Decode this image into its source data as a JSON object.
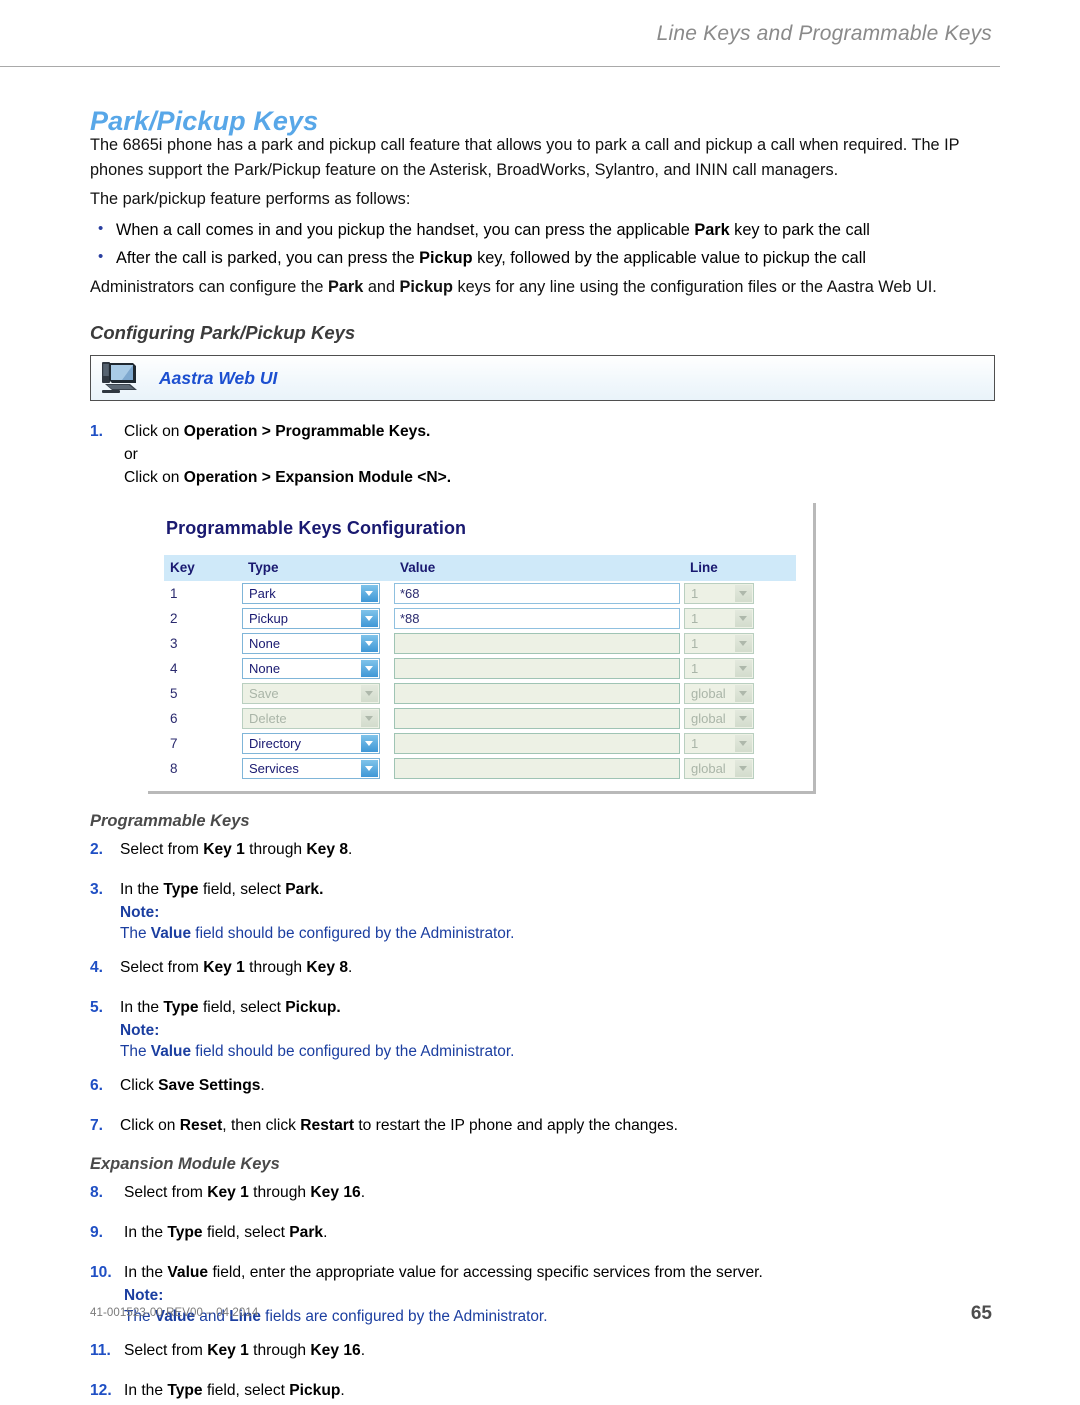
{
  "header": {
    "running_head": "Line Keys and Programmable Keys"
  },
  "title": "Park/Pickup Keys",
  "intro": {
    "paragraph1_a": "The 6865i phone has a park and pickup call feature that allows you to park a call and pickup a call when required. The IP phones support the Park/Pickup feature on the Asterisk, BroadWorks, Sylantro, and ININ call managers.",
    "paragraph2": "The park/pickup feature performs as follows:",
    "bullet1_pre": "When a call comes in and you pickup the handset, you can press the applicable ",
    "bullet1_bold": "Park",
    "bullet1_post": " key to park the call",
    "bullet2_pre": "After the call is parked, you can press the ",
    "bullet2_bold": "Pickup",
    "bullet2_post": " key, followed by the applicable value to pickup the call",
    "paragraph3_pre": "Administrators can configure the ",
    "paragraph3_bold1": "Park",
    "paragraph3_mid": " and ",
    "paragraph3_bold2": "Pickup",
    "paragraph3_post": " keys for any line using the configuration files or the Aastra Web UI."
  },
  "section_heading": "Configuring Park/Pickup Keys",
  "banner": {
    "label": "Aastra Web UI",
    "icon": "monitor-icon"
  },
  "step1": {
    "number": "1.",
    "line1_pre": "Click on ",
    "line1_bold": "Operation > Programmable Keys.",
    "line2": "or",
    "line3_pre": "Click on ",
    "line3_bold": "Operation > Expansion Module <N>."
  },
  "screenshot": {
    "title": "Programmable Keys Configuration",
    "columns": [
      "Key",
      "Type",
      "Value",
      "Line"
    ],
    "rows": [
      {
        "key": "1",
        "type": "Park",
        "type_disabled": false,
        "value": "*68",
        "value_disabled": false,
        "line": "1",
        "line_disabled": true
      },
      {
        "key": "2",
        "type": "Pickup",
        "type_disabled": false,
        "value": "*88",
        "value_disabled": false,
        "line": "1",
        "line_disabled": true
      },
      {
        "key": "3",
        "type": "None",
        "type_disabled": false,
        "value": "",
        "value_disabled": true,
        "line": "1",
        "line_disabled": true
      },
      {
        "key": "4",
        "type": "None",
        "type_disabled": false,
        "value": "",
        "value_disabled": true,
        "line": "1",
        "line_disabled": true
      },
      {
        "key": "5",
        "type": "Save",
        "type_disabled": true,
        "value": "",
        "value_disabled": true,
        "line": "global",
        "line_disabled": true
      },
      {
        "key": "6",
        "type": "Delete",
        "type_disabled": true,
        "value": "",
        "value_disabled": true,
        "line": "global",
        "line_disabled": true
      },
      {
        "key": "7",
        "type": "Directory",
        "type_disabled": false,
        "value": "",
        "value_disabled": true,
        "line": "1",
        "line_disabled": true
      },
      {
        "key": "8",
        "type": "Services",
        "type_disabled": false,
        "value": "",
        "value_disabled": true,
        "line": "global",
        "line_disabled": true
      }
    ]
  },
  "sub_heading_programmable": "Programmable Keys",
  "step2": {
    "number": "2.",
    "pre": "Select from ",
    "bold1": "Key 1",
    "mid": " through ",
    "bold2": "Key 8",
    "post": "."
  },
  "step3": {
    "number": "3.",
    "pre": "In the ",
    "bold1": "Type",
    "mid": " field, select ",
    "bold2": "Park.",
    "note_label": "Note:",
    "note_pre": "The ",
    "note_bold": "Value",
    "note_post": " field should be configured by the Administrator."
  },
  "step4": {
    "number": "4.",
    "pre": "Select from ",
    "bold1": "Key 1",
    "mid": " through ",
    "bold2": "Key 8",
    "post": "."
  },
  "step5": {
    "number": "5.",
    "pre": "In the ",
    "bold1": "Type",
    "mid": " field, select ",
    "bold2": "Pickup.",
    "note_label": "Note:",
    "note_pre": "The ",
    "note_bold": "Value",
    "note_post": " field should be configured by the Administrator."
  },
  "step6": {
    "number": "6.",
    "pre": "Click ",
    "bold1": "Save Settings",
    "post": "."
  },
  "step7": {
    "number": "7.",
    "pre": "Click on ",
    "bold1": "Reset",
    "mid": ", then click ",
    "bold2": "Restart",
    "post": " to restart the IP phone and apply the changes."
  },
  "sub_heading_expansion": "Expansion Module Keys",
  "step8": {
    "number": "8.",
    "pre": "Select from ",
    "bold1": "Key 1",
    "mid": " through ",
    "bold2": "Key 16",
    "post": "."
  },
  "step9": {
    "number": "9.",
    "pre": "In the ",
    "bold1": "Type",
    "mid": " field, select ",
    "bold2": "Park",
    "post": "."
  },
  "step10": {
    "number": "10.",
    "pre": "In the ",
    "bold1": "Value",
    "post": " field, enter the appropriate value for accessing specific services from the server.",
    "note_label": "Note:",
    "note_pre": "The ",
    "note_bold1": "Value",
    "note_mid": " and ",
    "note_bold2": "Line",
    "note_post": " fields are configured by the Administrator."
  },
  "step11": {
    "number": "11.",
    "pre": "Select from ",
    "bold1": "Key 1",
    "mid": " through ",
    "bold2": "Key 16",
    "post": "."
  },
  "step12": {
    "number": "12.",
    "pre": "In the ",
    "bold1": "Type",
    "mid": " field, select ",
    "bold2": "Pickup",
    "post": "."
  },
  "footer": {
    "doc_id": "41-001523-00 REV00 – 04.2014",
    "page_number": "65"
  },
  "colors": {
    "title_blue": "#58a7e8",
    "note_blue": "#1b3ea0",
    "step_number_blue": "#1f4fc4",
    "banner_label_blue": "#1c4fd0",
    "table_header_bg": "#cfe9f9",
    "table_header_text": "#191970",
    "disabled_field_bg": "#edf1e5"
  }
}
